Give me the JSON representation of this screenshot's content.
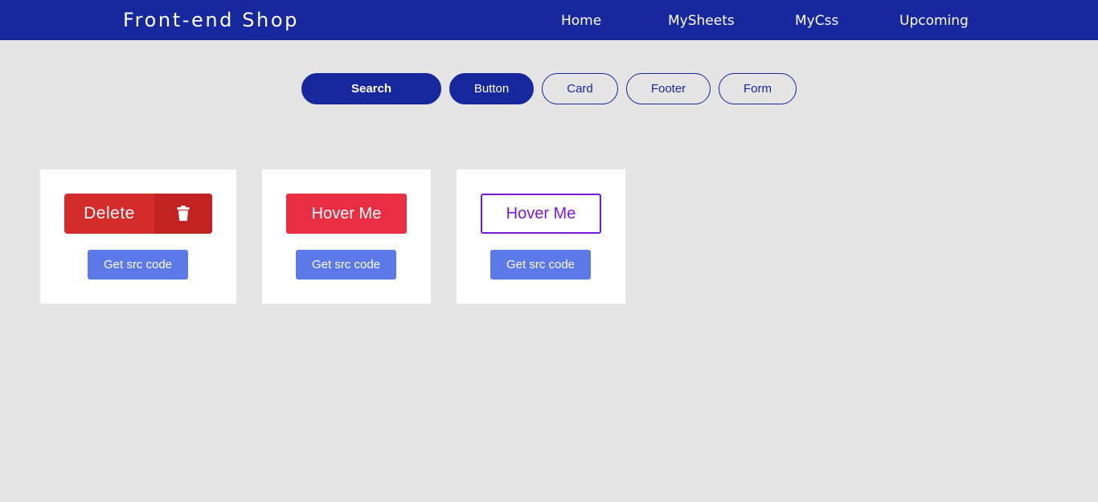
{
  "navbar": {
    "brand": "Front-end Shop",
    "links": [
      "Home",
      "MySheets",
      "MyCss",
      "Upcoming"
    ]
  },
  "filters": {
    "search_label": "Search",
    "categories": [
      "Button",
      "Card",
      "Footer",
      "Form"
    ],
    "active_category": "Button"
  },
  "cards": [
    {
      "demo_label": "Delete",
      "demo_icon": "trash-icon",
      "action_label": "Get src code"
    },
    {
      "demo_label": "Hover Me",
      "action_label": "Get src code"
    },
    {
      "demo_label": "Hover Me",
      "action_label": "Get src code"
    }
  ],
  "colors": {
    "primary": "#17279e",
    "background": "#e5e5e5",
    "delete_red": "#d32a2a",
    "hover_red": "#e92d42",
    "outline_purple": "#7a18e0",
    "src_button_blue": "#5c79e8"
  }
}
